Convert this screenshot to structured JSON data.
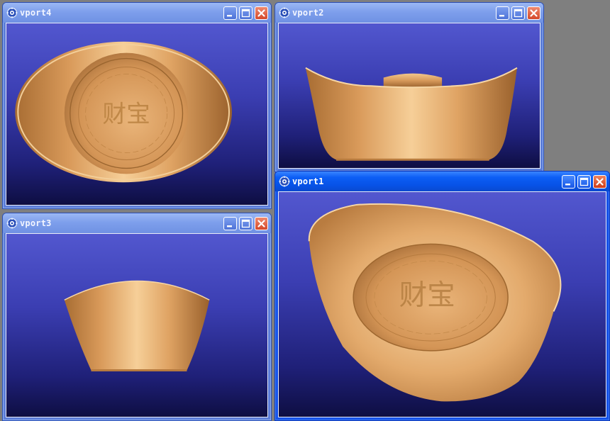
{
  "viewports": {
    "vport4": {
      "title": "vport4",
      "view": "top"
    },
    "vport2": {
      "title": "vport2",
      "view": "front"
    },
    "vport3": {
      "title": "vport3",
      "view": "side"
    },
    "vport1": {
      "title": "vport1",
      "view": "perspective"
    }
  },
  "window_buttons": [
    "minimize",
    "maximize",
    "close"
  ],
  "engraving_text": "财宝",
  "colors": {
    "desktop": "#7f7f7f",
    "titlebar_inactive": "#7e9fec",
    "titlebar_active": "#0c5ef5",
    "viewport_bg_top": "#5257cf",
    "viewport_bg_bottom": "#0e0e42",
    "gold_light": "#f6cf98",
    "gold_mid": "#d99a5a",
    "gold_dark": "#8a5424"
  }
}
